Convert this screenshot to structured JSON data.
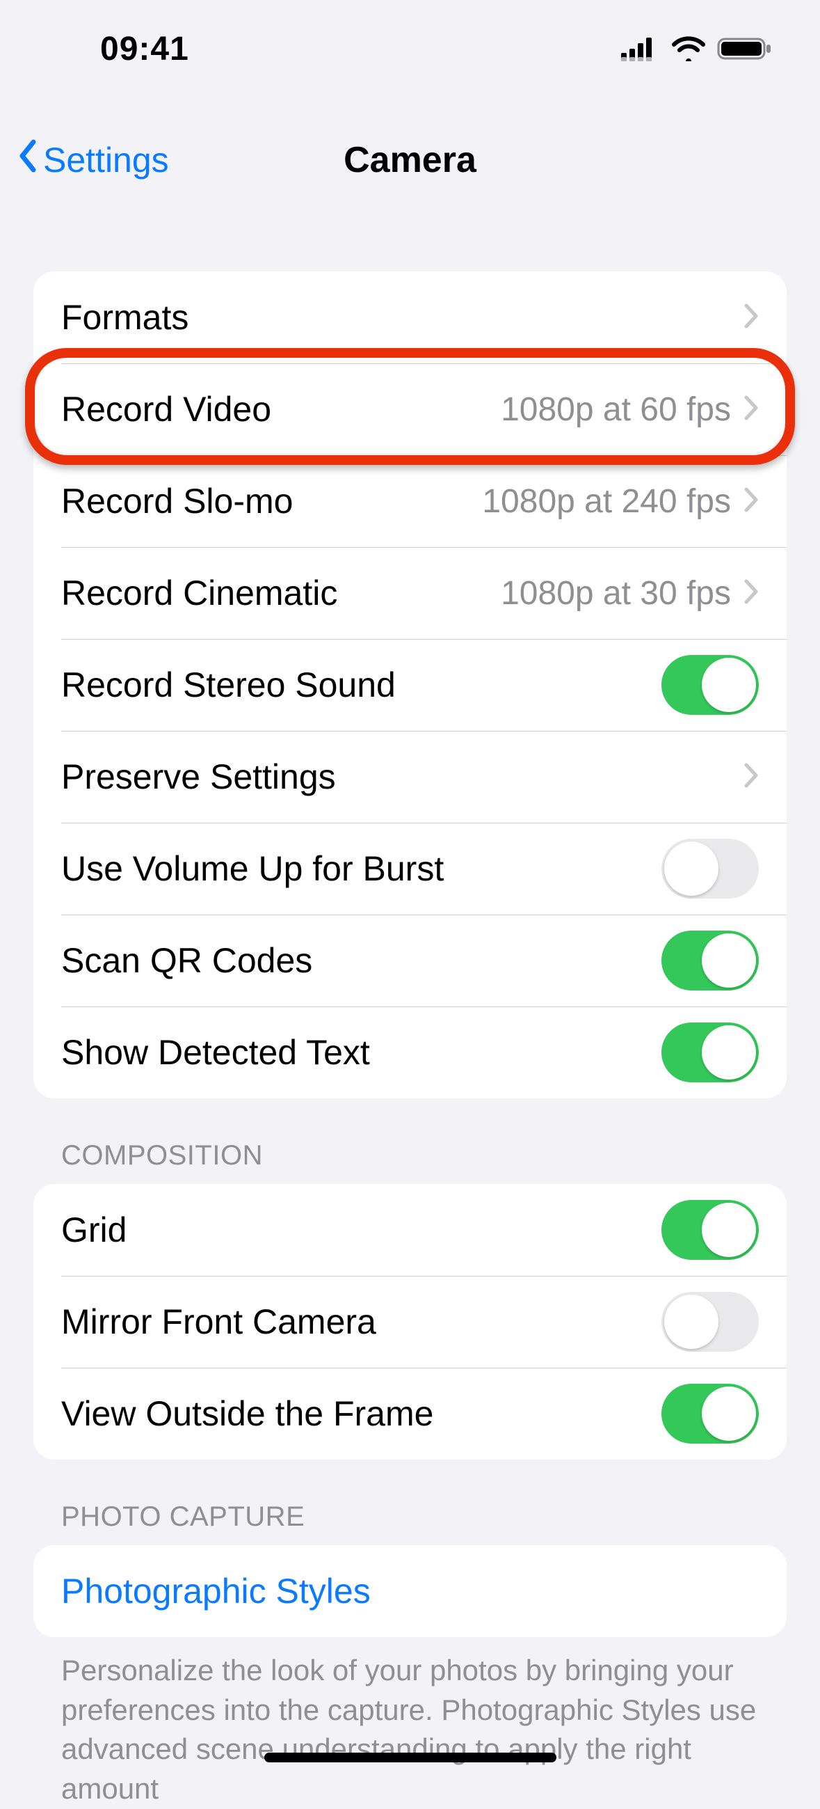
{
  "status": {
    "time": "09:41"
  },
  "nav": {
    "back_label": "Settings",
    "title": "Camera"
  },
  "group1": {
    "formats": {
      "label": "Formats"
    },
    "record_video": {
      "label": "Record Video",
      "value": "1080p at 60 fps"
    },
    "record_slomo": {
      "label": "Record Slo-mo",
      "value": "1080p at 240 fps"
    },
    "record_cinematic": {
      "label": "Record Cinematic",
      "value": "1080p at 30 fps"
    },
    "stereo_sound": {
      "label": "Record Stereo Sound",
      "on": true
    },
    "preserve_settings": {
      "label": "Preserve Settings"
    },
    "volume_burst": {
      "label": "Use Volume Up for Burst",
      "on": false
    },
    "scan_qr": {
      "label": "Scan QR Codes",
      "on": true
    },
    "detected_text": {
      "label": "Show Detected Text",
      "on": true
    }
  },
  "composition": {
    "header": "COMPOSITION",
    "grid": {
      "label": "Grid",
      "on": true
    },
    "mirror": {
      "label": "Mirror Front Camera",
      "on": false
    },
    "outside_frame": {
      "label": "View Outside the Frame",
      "on": true
    }
  },
  "photo_capture": {
    "header": "PHOTO CAPTURE",
    "styles": {
      "label": "Photographic Styles"
    },
    "footer": "Personalize the look of your photos by bringing your preferences into the capture. Photographic Styles use advanced scene understanding to apply the right amount"
  }
}
